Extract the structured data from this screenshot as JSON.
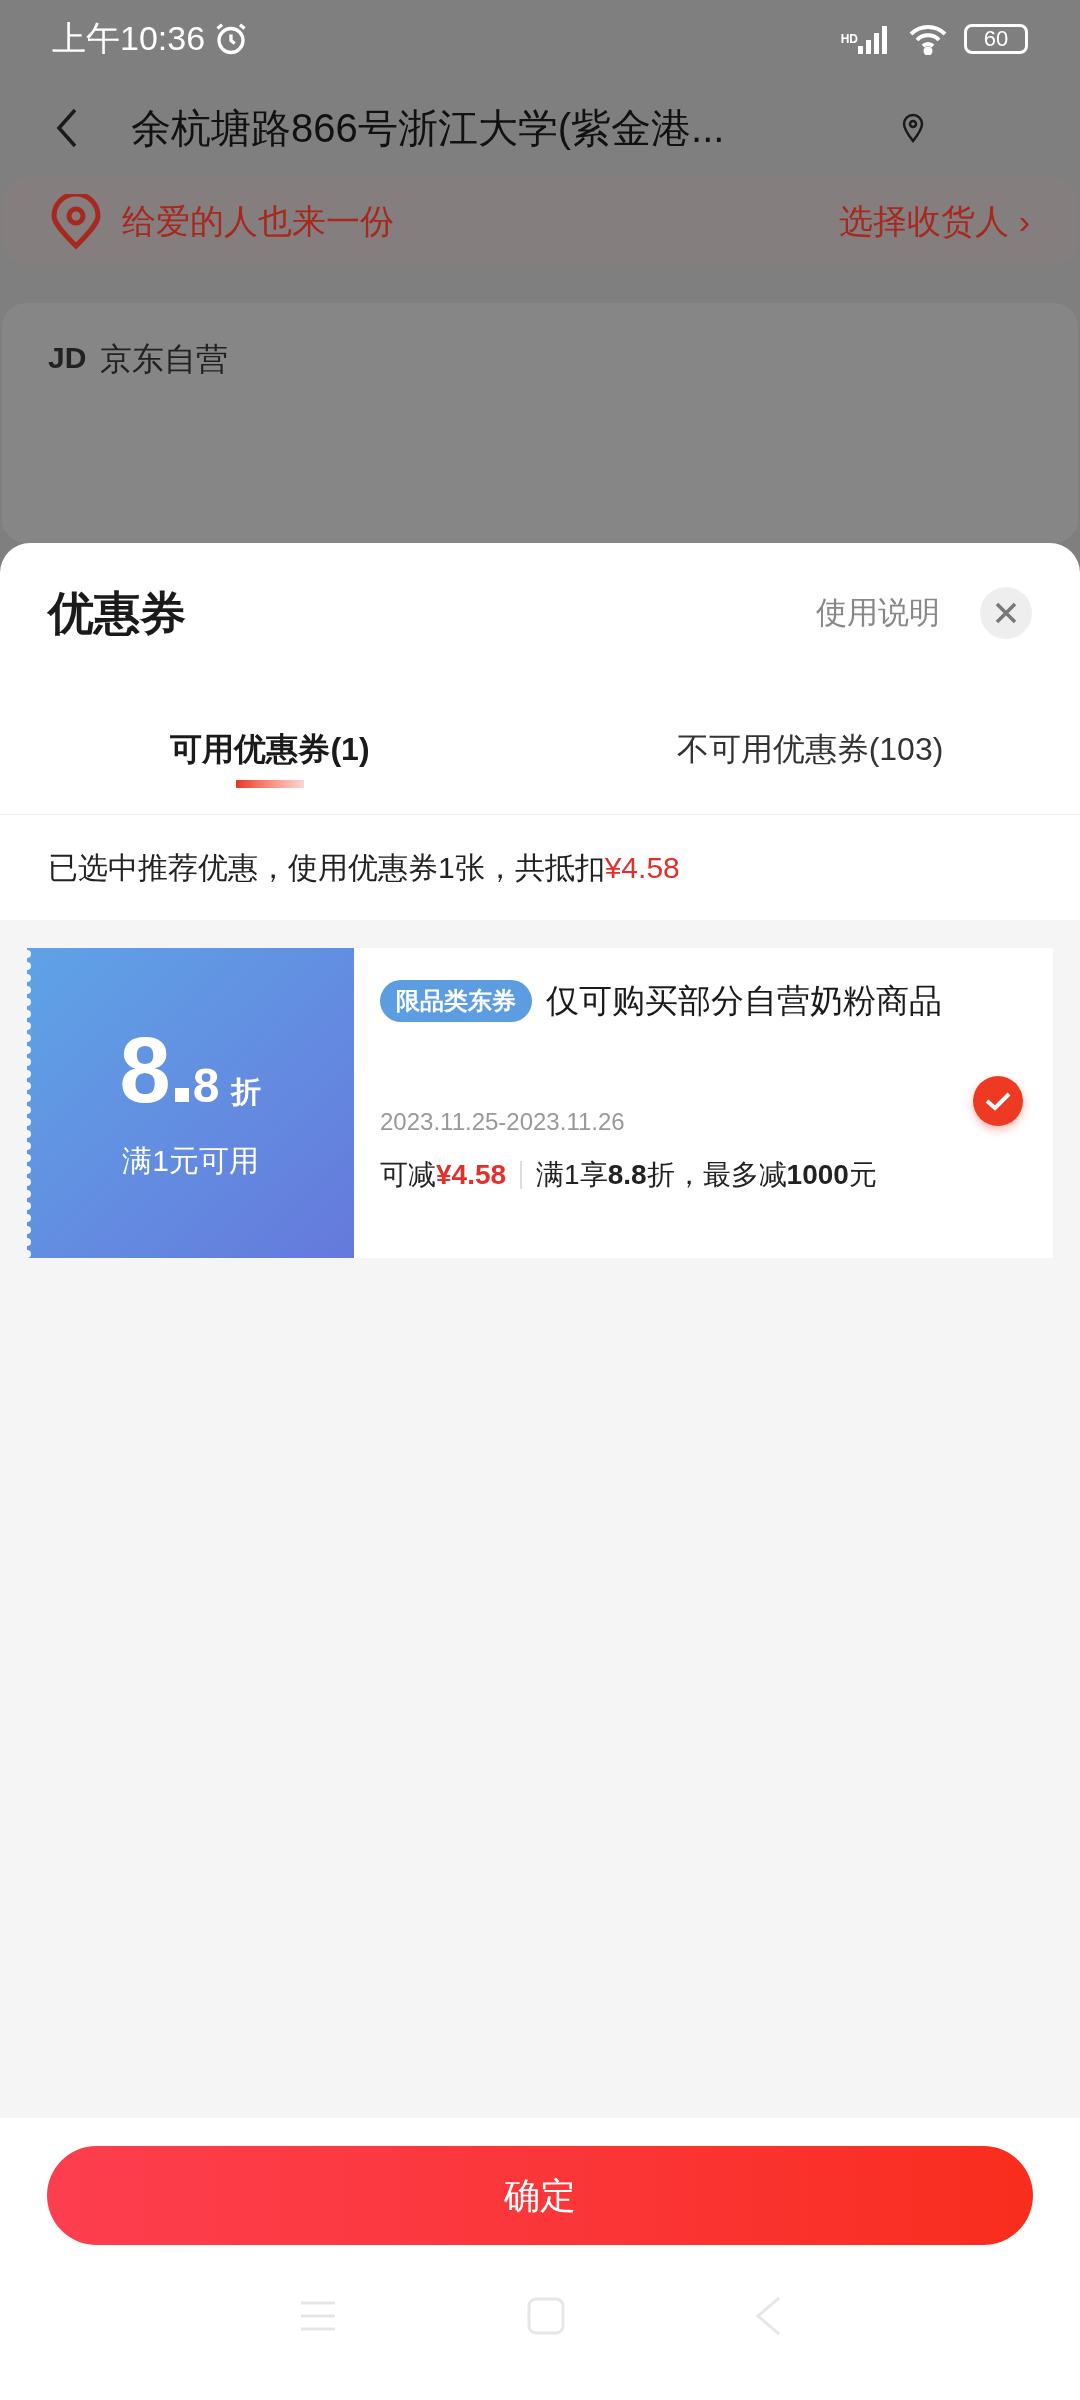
{
  "status_bar": {
    "time": "上午10:36",
    "network": "HD",
    "battery": "60"
  },
  "header": {
    "address": "余杭塘路866号浙江大学(紫金港..."
  },
  "gift_banner": {
    "text": "给爱的人也来一份",
    "action": "选择收货人",
    "chevron": "›"
  },
  "store": {
    "logo": "JD",
    "name": "京东自营"
  },
  "sheet": {
    "title": "优惠券",
    "help": "使用说明",
    "tabs": [
      {
        "label": "可用优惠券(1)",
        "selected": true
      },
      {
        "label": "不可用优惠券(103)",
        "selected": false
      }
    ],
    "summary": {
      "text": "已选中推荐优惠，使用优惠券1张，共抵扣",
      "amount": "¥4.58"
    },
    "coupons": [
      {
        "value_int": "8",
        "value_dec": "8",
        "unit": "折",
        "condition": "满1元可用",
        "tag": "限品类东券",
        "title": "仅可购买部分自营奶粉商品",
        "validity": "2023.11.25-2023.11.26",
        "saving_label": "可减",
        "saving_amount": "¥4.58",
        "rule": "满1享**8.8**折，最多减**1000**元",
        "selected": true
      }
    ],
    "confirm": "确定"
  }
}
